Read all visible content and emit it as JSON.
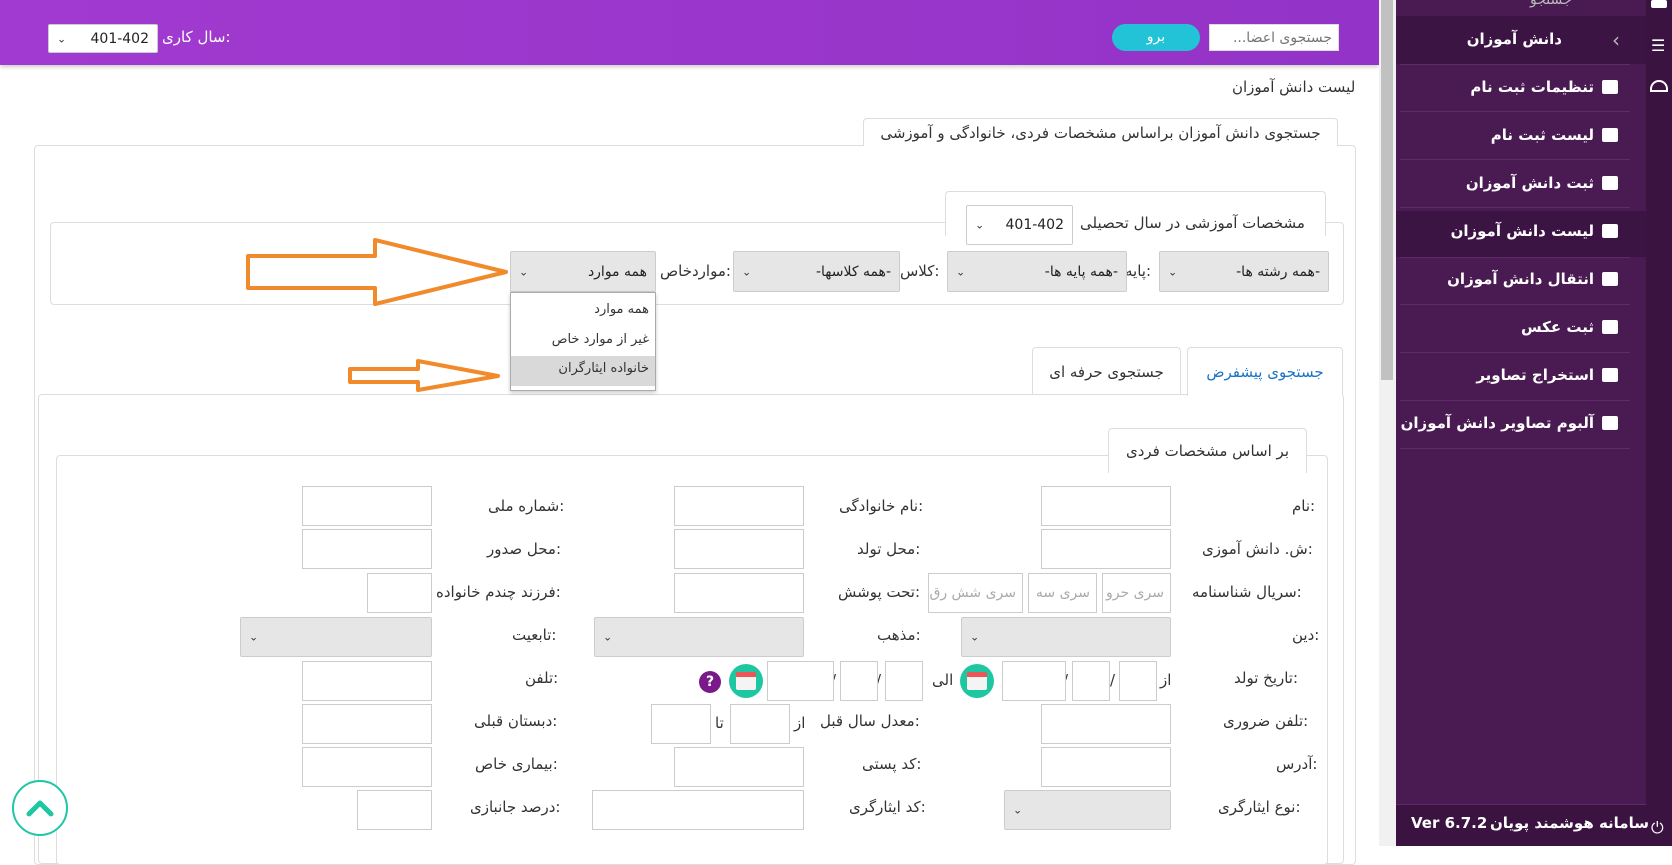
{
  "header": {
    "year_label": "سال کاری:",
    "year_value": "401-402",
    "search_placeholder": "جستجوی اعضا...",
    "go_button": "برو"
  },
  "sidebar": {
    "top_partial": "جستجو",
    "items": [
      {
        "label": "دانش آموزان"
      },
      {
        "label": "تنظیمات ثبت نام"
      },
      {
        "label": "لیست ثبت نام"
      },
      {
        "label": "ثبت دانش آموزان"
      },
      {
        "label": "لیست دانش آموزان"
      },
      {
        "label": "انتقال دانش آموزان"
      },
      {
        "label": "ثبت عکس"
      },
      {
        "label": "استخراج تصاویر"
      },
      {
        "label": "آلبوم تصاویر دانش آموزان"
      }
    ],
    "footer_title": "سامانه هوشمند پویان",
    "footer_version": "Ver 6.7.2"
  },
  "page": {
    "breadcrumb": "لیست دانش آموزان",
    "main_tab": "جستجوی دانش آموزان براساس مشخصات فردی، خانوادگی و آموزشی"
  },
  "edu": {
    "legend": "مشخصات آموزشی در سال تحصیلی",
    "year_value": "401-402",
    "field_value": "-همه رشته ها-",
    "grade_label": "پایه:",
    "grade_value": "-همه پایه ها-",
    "class_label": "کلاس:",
    "class_value": "-همه کلاسها-",
    "special_label": "مواردخاص:",
    "special_value": "همه موارد",
    "dropdown_options": [
      "همه موارد",
      "غیر از موارد خاص",
      "خانواده ایثارگران"
    ]
  },
  "tabs": {
    "default": "جستجوی پیشفرض",
    "pro": "جستجوی حرفه ای"
  },
  "personal": {
    "legend": "بر اساس مشخصات فردی",
    "name": "نام:",
    "family": "نام خانوادگی:",
    "national_id": "شماره ملی:",
    "student_no": "ش. دانش آموزی:",
    "birth_place": "محل تولد:",
    "issue_place": "محل صدور:",
    "serial": "سریال شناسنامه:",
    "serial_ph1": "سری حرو",
    "serial_ph2": "سری سه",
    "serial_ph3": "سری شش رق",
    "covered": "تحت پوشش:",
    "child_no": "فرزند چندم خانواده:",
    "religion": "دین:",
    "sect": "مذهب:",
    "nationality": "تابعیت:",
    "birth_date": "تاریخ تولد:",
    "from": "از",
    "to_date": "الی",
    "sep": "/",
    "phone": "تلفن:",
    "emergency_phone": "تلفن ضروری:",
    "prev_avg": "معدل سال قبل:",
    "avg_from": "از",
    "avg_to": "تا",
    "prev_school": "دبستان قبلی:",
    "address": "آدرس:",
    "postal_code": "کد پستی:",
    "disease": "بیماری خاص:",
    "sacrifice_type": "نوع ایثارگری:",
    "sacrifice_code": "کد ایثارگری:",
    "disability_pct": "درصد جانبازی:",
    "help": "?"
  },
  "colors": {
    "header": "#9b36cc",
    "sidebar": "#4a1a52",
    "go_button": "#22c3d6",
    "arrow": "#f08a2a",
    "active_tab": "#1a73c8"
  }
}
